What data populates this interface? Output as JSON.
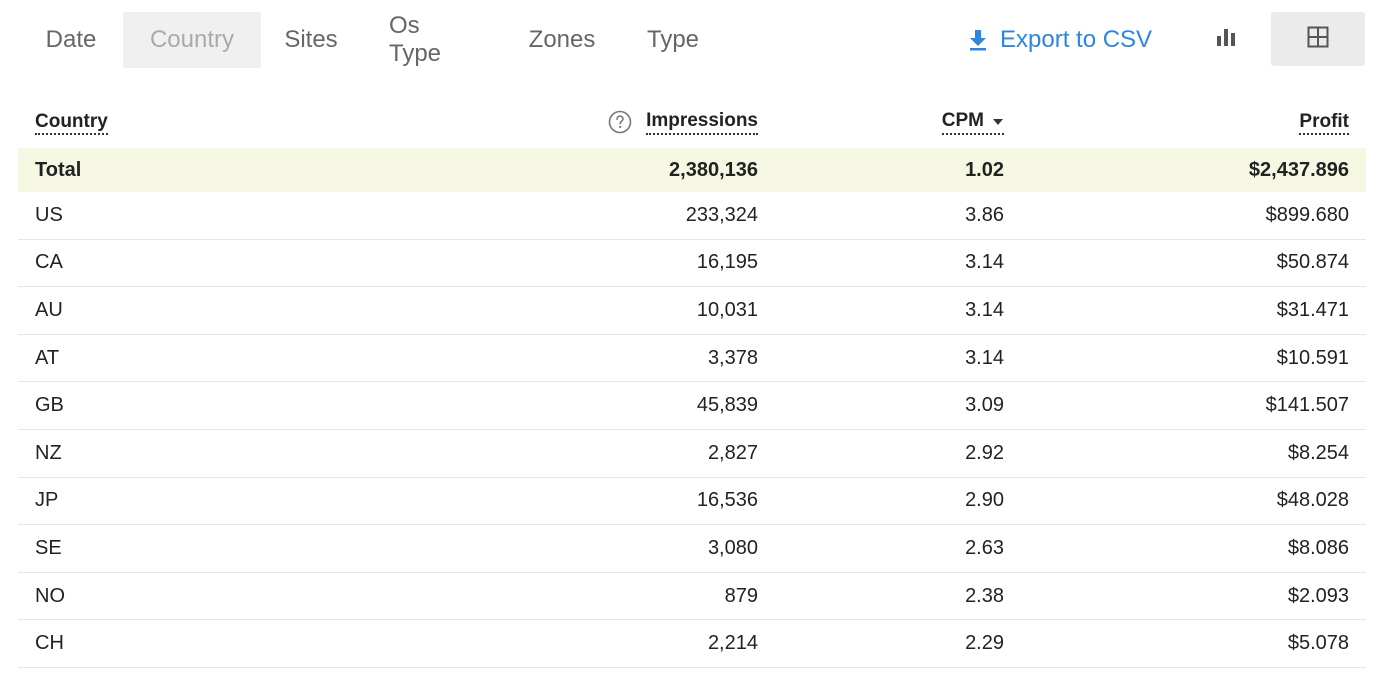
{
  "tabs": [
    {
      "label": "Date",
      "active": false
    },
    {
      "label": "Country",
      "active": true
    },
    {
      "label": "Sites",
      "active": false
    },
    {
      "label": "Os Type",
      "active": false
    },
    {
      "label": "Zones",
      "active": false
    },
    {
      "label": "Type",
      "active": false
    }
  ],
  "toolbar": {
    "export_label": "Export to CSV",
    "export_icon": "download-icon",
    "chart_view_icon": "bar-chart-icon",
    "table_view_icon": "grid-icon",
    "accent_color": "#2f86e0"
  },
  "table": {
    "headers": {
      "country": "Country",
      "impressions": "Impressions",
      "cpm": "CPM",
      "profit": "Profit"
    },
    "sort": {
      "column": "cpm",
      "direction": "descending"
    },
    "total": {
      "country": "Total",
      "impressions": "2,380,136",
      "cpm": "1.02",
      "profit": "$2,437.896"
    },
    "rows": [
      {
        "country": "US",
        "impressions": "233,324",
        "cpm": "3.86",
        "profit": "$899.680"
      },
      {
        "country": "CA",
        "impressions": "16,195",
        "cpm": "3.14",
        "profit": "$50.874"
      },
      {
        "country": "AU",
        "impressions": "10,031",
        "cpm": "3.14",
        "profit": "$31.471"
      },
      {
        "country": "AT",
        "impressions": "3,378",
        "cpm": "3.14",
        "profit": "$10.591"
      },
      {
        "country": "GB",
        "impressions": "45,839",
        "cpm": "3.09",
        "profit": "$141.507"
      },
      {
        "country": "NZ",
        "impressions": "2,827",
        "cpm": "2.92",
        "profit": "$8.254"
      },
      {
        "country": "JP",
        "impressions": "16,536",
        "cpm": "2.90",
        "profit": "$48.028"
      },
      {
        "country": "SE",
        "impressions": "3,080",
        "cpm": "2.63",
        "profit": "$8.086"
      },
      {
        "country": "NO",
        "impressions": "879",
        "cpm": "2.38",
        "profit": "$2.093"
      },
      {
        "country": "CH",
        "impressions": "2,214",
        "cpm": "2.29",
        "profit": "$5.078"
      }
    ]
  }
}
